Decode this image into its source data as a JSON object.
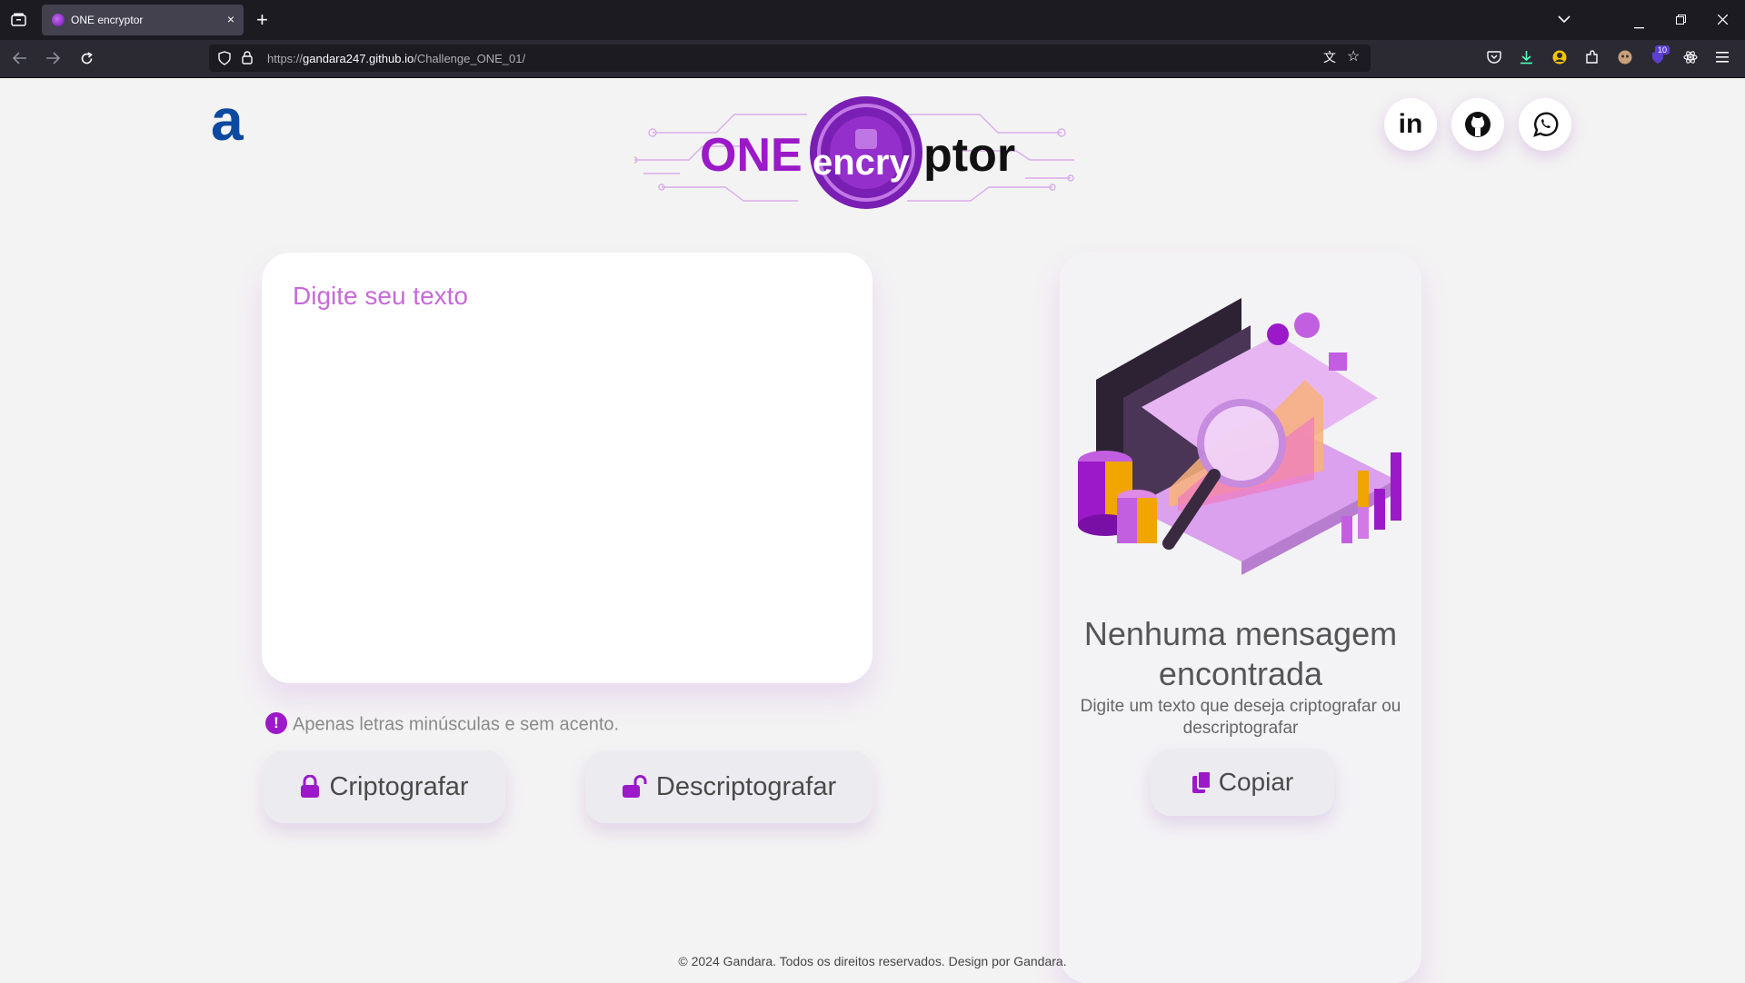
{
  "browser": {
    "tab_title": "ONE encryptor",
    "tab_close": "×",
    "new_tab": "+",
    "url_prefix": "https://",
    "url_host": "gandara247.github.io",
    "url_path": "/Challenge_ONE_01/",
    "extension_badge": "10"
  },
  "header": {
    "alura_logo": "a",
    "logo_text_left": "ONE",
    "logo_text_mid": "encry",
    "logo_text_right": "ptor",
    "social": [
      "linkedin-icon",
      "github-icon",
      "whatsapp-icon"
    ],
    "linkedin_text": "in"
  },
  "input": {
    "placeholder": "Digite seu texto"
  },
  "warning": {
    "icon": "!",
    "text": "Apenas letras minúsculas e sem acento."
  },
  "buttons": {
    "encrypt": "Criptografar",
    "decrypt": "Descriptografar",
    "copy": "Copiar"
  },
  "output": {
    "title": "Nenhuma mensagem encontrada",
    "subtitle": "Digite um texto que deseja criptografar ou descriptografar"
  },
  "footer": {
    "text": "© 2024 Gandara. Todos os direitos reservados. Design por Gandara."
  },
  "colors": {
    "accent": "#9b19c9",
    "placeholder": "#c66ad8",
    "alura_blue": "#0b4aa0",
    "page_bg": "#f3f3f3"
  }
}
